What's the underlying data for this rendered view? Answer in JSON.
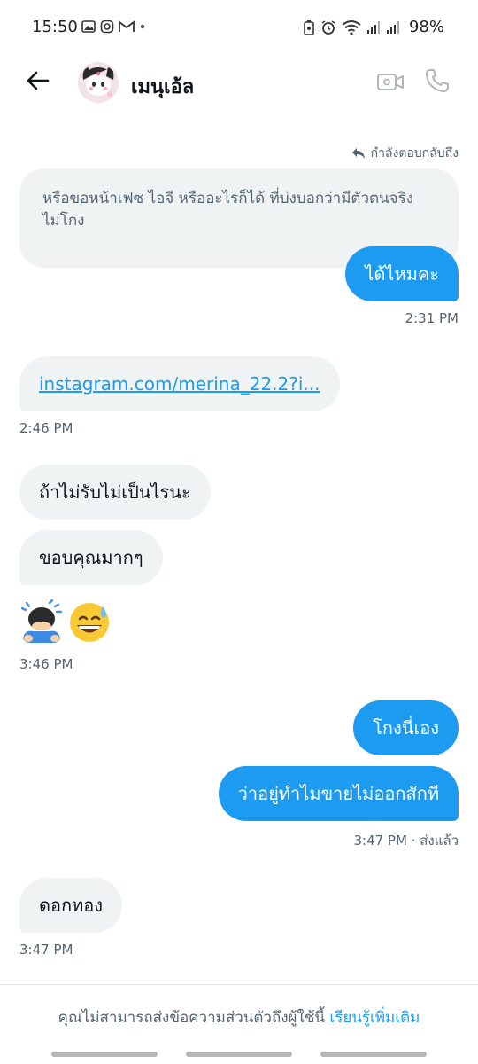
{
  "status_bar": {
    "time": "15:50",
    "battery": "98%"
  },
  "header": {
    "name": "เมนุเอ้ล"
  },
  "reply_note": "กำลังตอบกลับถึง",
  "quoted_message": "หรือขอหน้าเฟซ ไอจี หรืออะไรก็ได้ ที่บ่งบอกว่ามีตัวตนจริง ไม่โกง",
  "messages": [
    {
      "text": "ได้ไหมคะ",
      "time": "2:31 PM"
    },
    {
      "link": "instagram.com/merina_22.2?i...",
      "time": "2:46 PM"
    },
    {
      "text": "ถ้าไม่รับไม่เป็นไรนะ"
    },
    {
      "text": "ขอบคุณมากๆ"
    },
    {
      "emoji": [
        "🙇",
        "😅"
      ],
      "time": "3:46 PM"
    },
    {
      "text": "โกงนี่เอง"
    },
    {
      "text": "ว่าอยู่ทำไมขายไม่ออกสักที",
      "time": "3:47 PM · ส่งแล้ว"
    },
    {
      "text": "ดอกทอง",
      "time": "3:47 PM"
    }
  ],
  "footer": {
    "text": "คุณไม่สามารถส่งข้อความส่วนตัวถึงผู้ใช้นี้ ",
    "link": "เรียนรู้เพิ่มเติม"
  },
  "colors": {
    "accent": "#1d9bf0",
    "incoming_bubble": "#eff3f4",
    "muted_text": "#536471"
  }
}
